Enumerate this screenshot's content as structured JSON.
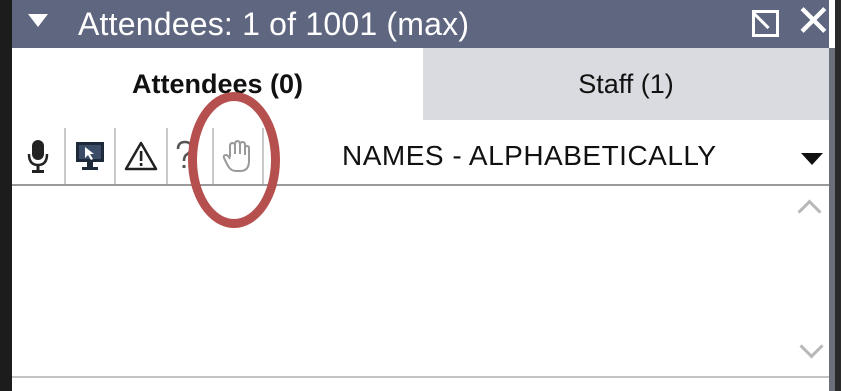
{
  "window": {
    "title": "Attendees:  1 of 1001 (max)",
    "close_glyph": "✕",
    "icons": [
      "collapse-triangle-icon",
      "popout-icon",
      "close-icon"
    ]
  },
  "tabs": [
    {
      "label": "Attendees (0)",
      "active": true
    },
    {
      "label": "Staff (1)",
      "active": false
    }
  ],
  "toolbar": {
    "icons": [
      "microphone-icon",
      "screen-share-icon",
      "warning-icon",
      "question-icon",
      "raise-hand-icon"
    ],
    "sort_label": "NAMES - ALPHABETICALLY"
  },
  "list": {
    "items": []
  },
  "colors": {
    "titlebar": "#5f6680",
    "inactive_tab": "#d9dbe0",
    "annotation": "#b5504f"
  }
}
